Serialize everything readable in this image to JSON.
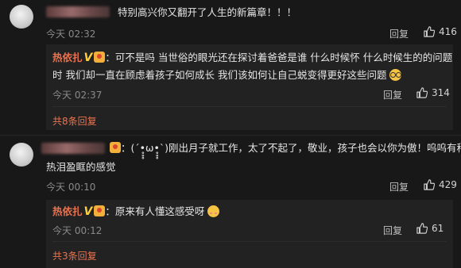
{
  "comments": [
    {
      "text": "特别高兴你又翻开了人生的新篇章！！！",
      "time": "今天 02:32",
      "reply_label": "回复",
      "likes": "416",
      "reply": {
        "author": "热依扎",
        "badge": "V",
        "line1": "：可不是吗  当世俗的眼光还在探讨着爸爸是谁 什么时候怀 什么时候生的的问题",
        "line2": "时 我们却一直在顾虑着孩子如何成长 我们该如何让自己蜕变得更好这些问题",
        "emoji": "glasses-emoji",
        "time": "今天 02:37",
        "reply_label": "回复",
        "likes": "314"
      },
      "more": "共8条回复"
    },
    {
      "line1": "：(´•̥̥̥ω•̥̥̥`)刚出月子就工作，太了不起了，敬业，孩子也会以你为傲！呜呜有种",
      "line2": "热泪盈眶的感觉",
      "time": "今天 00:10",
      "reply_label": "回复",
      "likes": "429",
      "reply": {
        "author": "热依扎",
        "badge": "V",
        "text": "：原来有人懂这感受呀",
        "emoji": "blush-emoji",
        "time": "今天 00:12",
        "reply_label": "回复",
        "likes": "61"
      },
      "more": "共3条回复"
    }
  ],
  "colors": {
    "background": "#181818",
    "reply_background": "#222222",
    "link": "#eb7350",
    "verified": "#ffcf3d"
  }
}
